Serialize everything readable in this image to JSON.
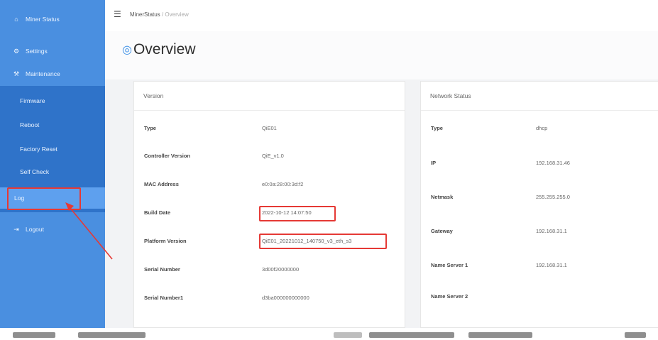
{
  "sidebar": {
    "items": [
      {
        "label": "Miner Status",
        "icon": "home-icon"
      },
      {
        "label": "Settings",
        "icon": "settings-icon"
      },
      {
        "label": "Maintenance",
        "icon": "wrench-icon"
      }
    ],
    "submenu": [
      {
        "label": "Firmware"
      },
      {
        "label": "Reboot"
      },
      {
        "label": "Factory Reset"
      },
      {
        "label": "Self Check"
      },
      {
        "label": "Log"
      }
    ],
    "logout": {
      "label": "Logout",
      "icon": "logout-icon"
    }
  },
  "breadcrumb": {
    "root": "MinerStatus",
    "separator": "/",
    "current": "Overview"
  },
  "page_title": "Overview",
  "version_card": {
    "title": "Version",
    "rows": [
      {
        "key": "Type",
        "value": "QiE01"
      },
      {
        "key": "Controller Version",
        "value": "QiE_v1.0"
      },
      {
        "key": "MAC Address",
        "value": "e0:0a:28:00:3d:f2"
      },
      {
        "key": "Build Date",
        "value": "2022-10-12 14:07:50"
      },
      {
        "key": "Platform Version",
        "value": "QiE01_20221012_140750_v3_eth_s3"
      },
      {
        "key": "Serial Number",
        "value": "3d00f20000000"
      },
      {
        "key": "Serial Number1",
        "value": "d3ba000000000000"
      }
    ]
  },
  "network_card": {
    "title": "Network Status",
    "rows": [
      {
        "key": "Type",
        "value": "dhcp"
      },
      {
        "key": "IP",
        "value": "192.168.31.46"
      },
      {
        "key": "Netmask",
        "value": "255.255.255.0"
      },
      {
        "key": "Gateway",
        "value": "192.168.31.1"
      },
      {
        "key": "Name Server 1",
        "value": "192.168.31.1"
      },
      {
        "key": "Name Server 2",
        "value": ""
      }
    ]
  },
  "colors": {
    "sidebar": "#4a8fe0",
    "submenu": "#2f73c9",
    "highlight": "#e53935",
    "accent": "#3a8ee6"
  }
}
